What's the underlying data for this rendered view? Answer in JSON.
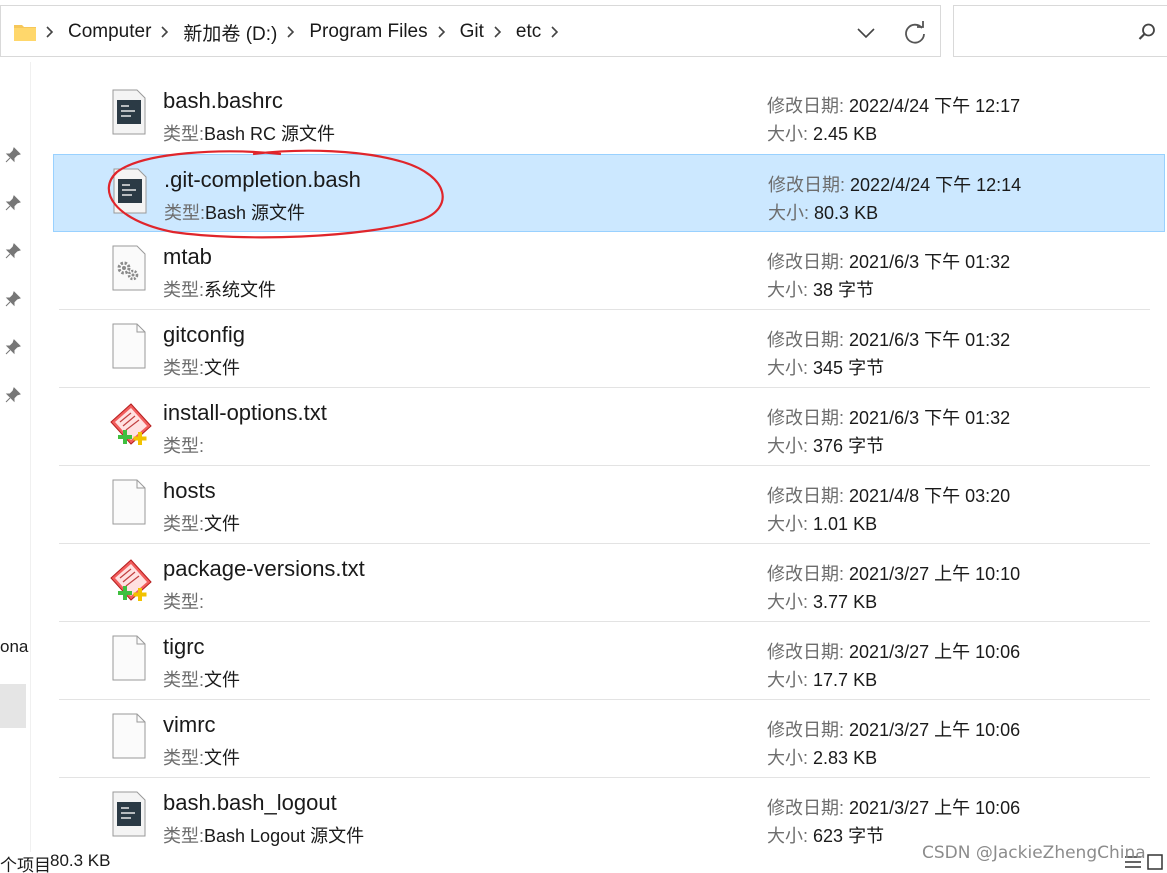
{
  "address": {
    "breadcrumbs": [
      "Computer",
      "新加卷 (D:)",
      "Program Files",
      "Git",
      "etc"
    ]
  },
  "search": {
    "placeholder": ""
  },
  "nav": {
    "cut_label": "ona"
  },
  "labels": {
    "date_key": "修改日期:",
    "size_key": "大小:",
    "type_key": "类型:"
  },
  "files": [
    {
      "name": "bash.bashrc",
      "type": "Bash RC 源文件",
      "modified": "2022/4/24 下午 12:17",
      "size": "2.45 KB",
      "icon": "bash-script-icon"
    },
    {
      "name": ".git-completion.bash",
      "type": "Bash 源文件",
      "modified": "2022/4/24 下午 12:14",
      "size": "80.3 KB",
      "icon": "bash-script-icon",
      "selected": true
    },
    {
      "name": "mtab",
      "type": "系统文件",
      "modified": "2021/6/3 下午 01:32",
      "size": "38 字节",
      "icon": "system-file-icon"
    },
    {
      "name": "gitconfig",
      "type": "文件",
      "modified": "2021/6/3 下午 01:32",
      "size": "345 字节",
      "icon": "blank-file-icon"
    },
    {
      "name": "install-options.txt",
      "type": "",
      "modified": "2021/6/3 下午 01:32",
      "size": "376 字节",
      "icon": "text-editor-icon"
    },
    {
      "name": "hosts",
      "type": "文件",
      "modified": "2021/4/8 下午 03:20",
      "size": "1.01 KB",
      "icon": "blank-file-icon"
    },
    {
      "name": "package-versions.txt",
      "type": "",
      "modified": "2021/3/27 上午 10:10",
      "size": "3.77 KB",
      "icon": "text-editor-icon"
    },
    {
      "name": "tigrc",
      "type": "文件",
      "modified": "2021/3/27 上午 10:06",
      "size": "17.7 KB",
      "icon": "blank-file-icon"
    },
    {
      "name": "vimrc",
      "type": "文件",
      "modified": "2021/3/27 上午 10:06",
      "size": "2.83 KB",
      "icon": "blank-file-icon"
    },
    {
      "name": "bash.bash_logout",
      "type": "Bash Logout 源文件",
      "modified": "2021/3/27 上午 10:06",
      "size": "623 字节",
      "icon": "bash-script-icon"
    }
  ],
  "status": {
    "count_text": "个项目",
    "selected_size": "80.3 KB"
  },
  "watermark": "CSDN @JackieZhengChina",
  "colors": {
    "selection_bg": "#cce8ff",
    "selection_border": "#99d1ff",
    "annotation": "#e0252b"
  }
}
